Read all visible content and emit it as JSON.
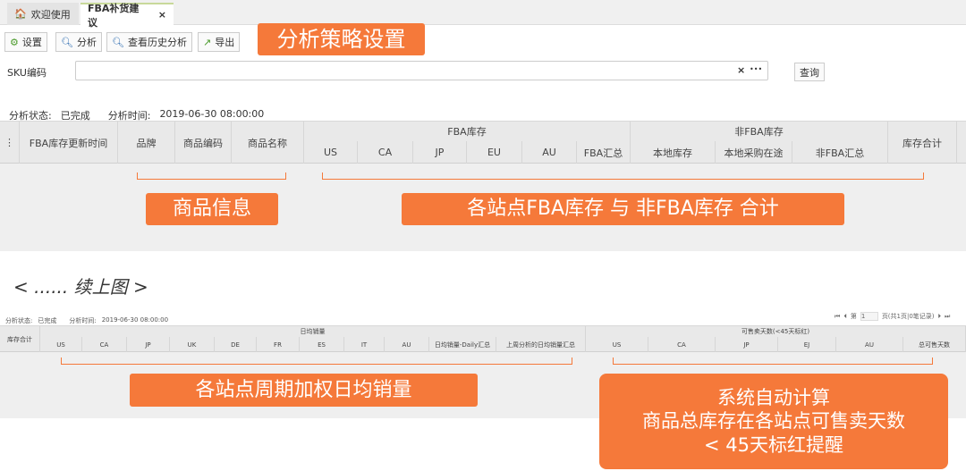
{
  "tabs": [
    {
      "label": "欢迎使用"
    },
    {
      "label": "FBA补货建议",
      "close": "×"
    }
  ],
  "toolbar": {
    "settings": "设置",
    "analyze": "分析",
    "history": "查看历史分析",
    "export": "导出"
  },
  "annotations": {
    "strategy": "分析策略设置",
    "product_info": "商品信息",
    "stock_total": "各站点FBA库存 与 非FBA库存 合计",
    "continued": "< ...... 续上图 >",
    "daily_sales": "各站点周期加权日均销量",
    "auto_calc": [
      "系统自动计算",
      "商品总库存在各站点可售卖天数",
      "< 45天标红提醒"
    ]
  },
  "search": {
    "label": "SKU编码",
    "value": "",
    "clear": "×",
    "more": "•••",
    "query": "查询"
  },
  "status": {
    "state_label": "分析状态:",
    "state": "已完成",
    "time_label": "分析时间:",
    "time": "2019-06-30 08:00:00"
  },
  "table1": {
    "menu": "⋮",
    "cols": [
      "FBA库存更新时间",
      "品牌",
      "商品编码",
      "商品名称"
    ],
    "fba_group": "FBA库存",
    "fba_cols": [
      "US",
      "CA",
      "JP",
      "EU",
      "AU",
      "FBA汇总"
    ],
    "nonfba_group": "非FBA库存",
    "nonfba_cols": [
      "本地库存",
      "本地采购在途",
      "非FBA汇总"
    ],
    "total": "库存合计"
  },
  "pager": {
    "page_prefix": "第",
    "page": "1",
    "page_suffix": "页(共1页|0笔记录)"
  },
  "table2": {
    "total": "库存合计",
    "sales_group": "日均销量",
    "sales_cols": [
      "US",
      "CA",
      "JP",
      "UK",
      "DE",
      "FR",
      "ES",
      "IT",
      "AU",
      "日均销量-Daily汇总",
      "上周分析的日均销量汇总"
    ],
    "days_group": "可售卖天数(<45天标红)",
    "days_cols": [
      "US",
      "CA",
      "JP",
      "EJ",
      "AU",
      "总可售天数"
    ]
  }
}
